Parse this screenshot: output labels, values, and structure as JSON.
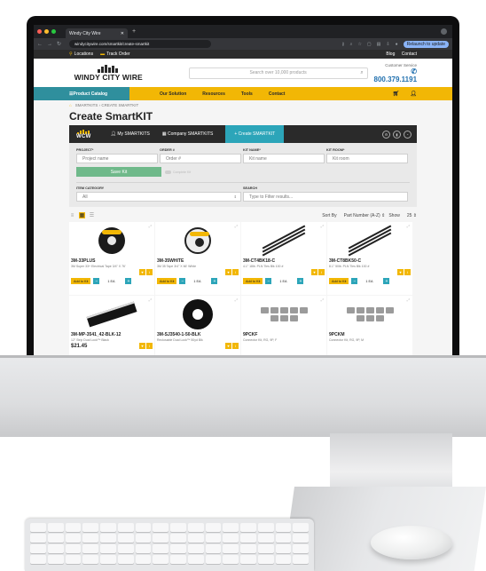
{
  "browser": {
    "tab_title": "Windy City Wire",
    "url": "windycitywire.com/smartkit/create-smartkit",
    "relaunch_label": "Relaunch to update"
  },
  "topbar": {
    "locations": "Locations",
    "track_order": "Track Order",
    "blog": "Blog",
    "contact": "Contact"
  },
  "header": {
    "logo_text": "WINDY CITY WIRE",
    "search_placeholder": "Search over 10,000 products",
    "cs_label": "Customer Service",
    "phone": "800.379.1191"
  },
  "nav": {
    "catalog": "Product Catalog",
    "links": [
      "Our Solution",
      "Resources",
      "Tools",
      "Contact"
    ]
  },
  "breadcrumb": {
    "smartkits": "SMARTKITS",
    "current": "CREATE SMARTKIT"
  },
  "page": {
    "title": "Create SmartKIT"
  },
  "kitbar": {
    "logo": "WCW",
    "my_smartkits": "My SMARTKITS",
    "company_smartkits": "Company SMARTKITS",
    "create": "+ Create SMARTKIT"
  },
  "form": {
    "project_label": "PROJECT*",
    "project_placeholder": "Project name",
    "order_label": "ORDER #",
    "order_placeholder": "Order #",
    "kitname_label": "KIT NAME*",
    "kitname_placeholder": "Kit name",
    "kitroom_label": "KIT ROOM*",
    "kitroom_placeholder": "Kit room",
    "save_label": "Save Kit",
    "toggle_label": "Complete Kit",
    "category_label": "ITEM CATEGORY",
    "category_value": "All",
    "search_label": "SEARCH",
    "search_placeholder": "Type to Filter results..."
  },
  "toolbar": {
    "sort_by": "Sort By",
    "sort_value": "Part Number (A-Z)",
    "show": "Show",
    "show_value": "25"
  },
  "products": [
    {
      "sku": "3M-33PLUS",
      "desc": "3M Super 33+ Electrical Tape 3/4\" X 76'",
      "art": "tape-black",
      "add": "Add to Kit",
      "qty": "1 EA"
    },
    {
      "sku": "3M-35WHITE",
      "desc": "3M 35 Tape 3/4\" X 66' White",
      "art": "tape-white",
      "add": "Add to Kit",
      "qty": "1 EA"
    },
    {
      "sku": "3M-CT4BK18-C",
      "desc": "4.1\" 18lb. PLN Ties Blk 100 #",
      "art": "ties",
      "add": "Add to Kit",
      "qty": "1 EA"
    },
    {
      "sku": "3M-CT8BK50-C",
      "desc": "8.1\" 50lb. PLN Ties Blk 100 #",
      "art": "ties",
      "add": "Add to Kit",
      "qty": "1 EA"
    },
    {
      "sku": "3M-MP-3541_42-BLK-12",
      "desc": "12\" Strip Dual Lock™ Black",
      "art": "strip",
      "price": "$21.45"
    },
    {
      "sku": "3M-SJ3540-1-50-BLK",
      "desc": "Reclosable Dual Lock™ 50yd Blk",
      "art": "roll"
    },
    {
      "sku": "9PCKF",
      "desc": "Connector Kit, RG, 9P, F",
      "art": "parts"
    },
    {
      "sku": "9PCKM",
      "desc": "Connector Kit, RG, 9P, M",
      "art": "parts"
    }
  ]
}
